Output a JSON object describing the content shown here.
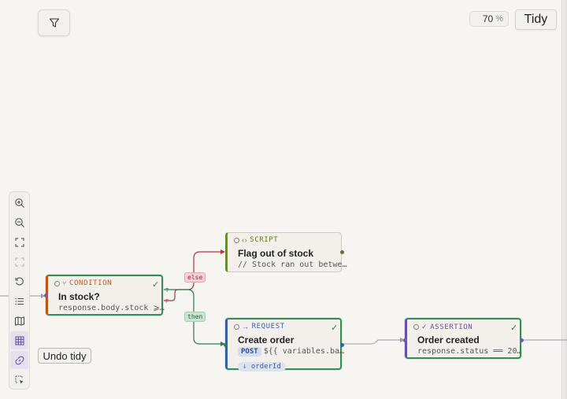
{
  "header": {
    "zoom_value": "70",
    "zoom_unit": "%",
    "tidy_label": "Tidy"
  },
  "undo_tidy_label": "Undo tidy",
  "toolbar": {
    "items": [
      "zoom-in-icon",
      "zoom-out-icon",
      "fit-view-icon",
      "fit-selection-icon",
      "reset-icon",
      "list-icon",
      "map-icon",
      "grid-icon",
      "link-icon",
      "select-icon"
    ]
  },
  "nodes": {
    "condition": {
      "type": "CONDITION",
      "title": "In stock?",
      "expr": "response.body.stock ⩾…"
    },
    "script": {
      "type": "SCRIPT",
      "title": "Flag out of stock",
      "code": "// Stock ran out betwe…"
    },
    "request": {
      "type": "REQUEST",
      "title": "Create order",
      "method": "POST",
      "url": "${{ variables.ba…",
      "output": "↓ orderId"
    },
    "assertion": {
      "type": "ASSERTION",
      "title": "Order created",
      "expr": "response.status",
      "op": "══",
      "value": "20…"
    }
  },
  "edge_labels": {
    "else": "else",
    "then": "then",
    "true_marker": "T",
    "false_marker": "F"
  },
  "colors": {
    "condition": "#c05a1e",
    "script": "#5a7a1f",
    "request": "#3a5fa8",
    "assertion": "#6a4fa8",
    "success_border": "#3a8a5a",
    "else_edge": "#b5333f",
    "then_edge": "#2f7a4f"
  }
}
